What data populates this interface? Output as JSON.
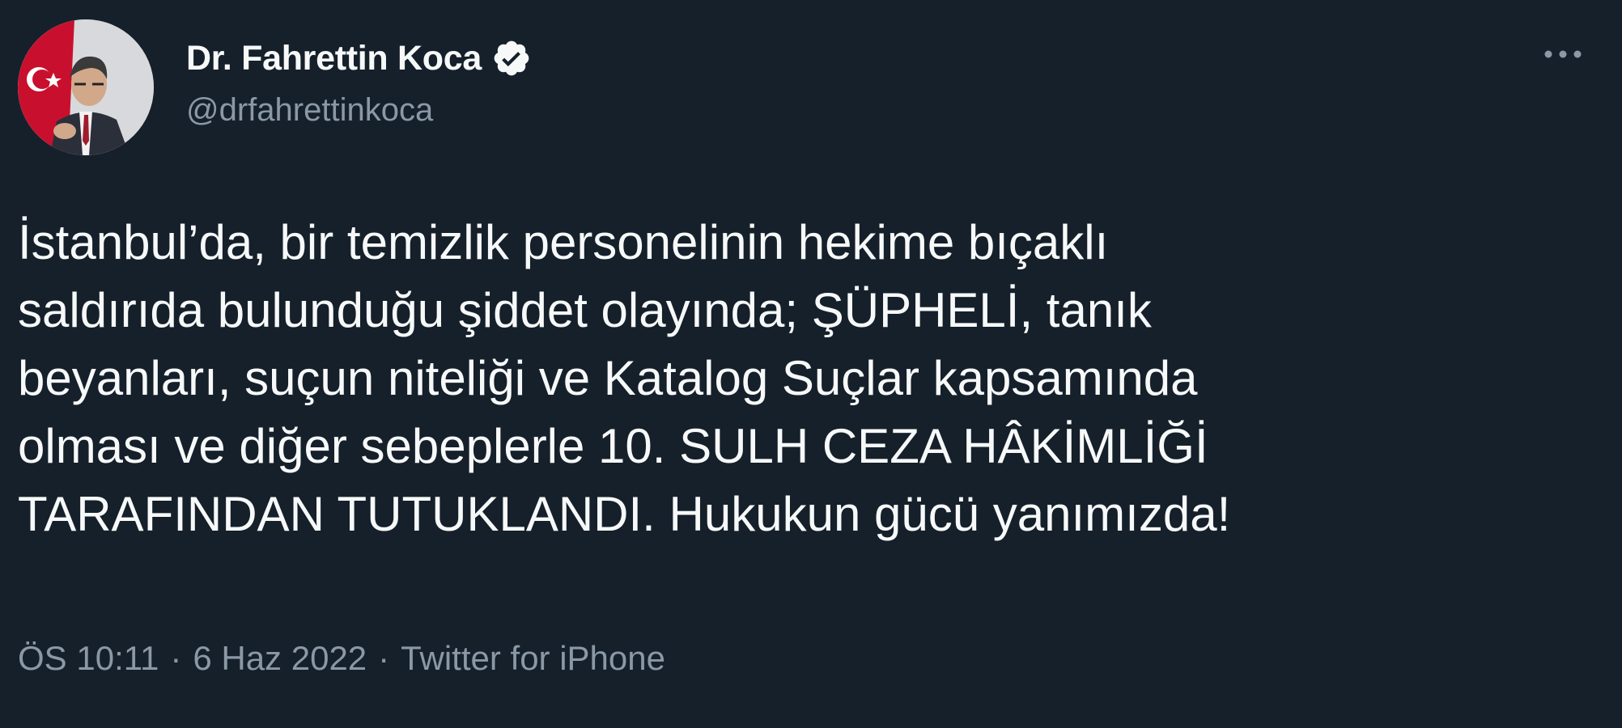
{
  "author": {
    "display_name": "Dr. Fahrettin Koca",
    "handle": "@drfahrettinkoca",
    "verified": true,
    "avatar_icon": "profile-photo"
  },
  "menu": {
    "icon": "more-options-icon"
  },
  "tweet": {
    "text": "İstanbul’da, bir temizlik personelinin hekime bıçaklı\nsaldırıda bulunduğu şiddet olayında; ŞÜPHELİ, tanık\nbeyanları, suçun niteliği ve Katalog Suçlar kapsamında\nolması ve diğer sebeplerle 10. SULH CEZA HÂKİMLİĞİ\nTARAFINDAN TUTUKLANDI. Hukukun gücü yanımızda!",
    "time": "ÖS 10:11",
    "separator": "·",
    "date": "6 Haz 2022",
    "source": "Twitter for iPhone"
  },
  "colors": {
    "background": "#15202b",
    "primary_text": "#f7f9f9",
    "secondary_text": "#8b98a5"
  }
}
